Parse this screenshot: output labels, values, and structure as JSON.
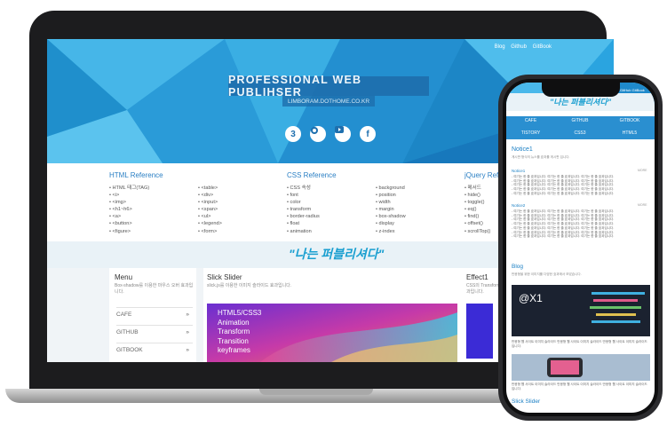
{
  "laptop": {
    "top_links": [
      "Blog",
      "Github",
      "GitBook"
    ],
    "site_title": "PROFESSIONAL WEB PUBLIHSER",
    "site_subtitle": "LIMBORAM.DOTHOME.CO.KR",
    "social_icons": [
      "css3-icon",
      "github-icon",
      "youtube-icon",
      "facebook-icon"
    ],
    "references": [
      {
        "title": "HTML Reference",
        "col1": [
          "HTML 태그(TAG)",
          "<i>",
          "<img>",
          "<h1~h6>",
          "<a>",
          "<button>",
          "<figure>"
        ],
        "col2": [
          "<table>",
          "<div>",
          "<input>",
          "<span>",
          "<ul>",
          "<legend>",
          "<form>"
        ]
      },
      {
        "title": "CSS Reference",
        "col1": [
          "CSS 속성",
          "font",
          "color",
          "transform",
          "border-radius",
          "float",
          "animation"
        ],
        "col2": [
          "background",
          "position",
          "width",
          "margin",
          "box-shadow",
          "display",
          "z-index"
        ]
      },
      {
        "title": "jQuery Refe",
        "col1": [
          "메서드",
          "hide()",
          "toggle()",
          "eq()",
          "find()",
          "offset()",
          "scrollTop()"
        ]
      }
    ],
    "slogan": "\"나는 퍼블리셔다\"",
    "menu": {
      "title": "Menu",
      "desc": "Box-shadow를 이용한 마우스 오버 효과입니다.",
      "items": [
        "CAFE",
        "GITHUB",
        "GITBOOK"
      ],
      "arrow": "»"
    },
    "slick": {
      "title": "Slick Slider",
      "desc": "slick.js를 이용한 이미지 슬라이드 효과입니다.",
      "words": [
        "HTML5/CSS3",
        "Animation",
        "Transform",
        "Transition",
        "keyframes"
      ]
    },
    "effect": {
      "title": "Effect1",
      "desc": "CSS의 Transform",
      "desc2": "과입니다."
    }
  },
  "phone": {
    "top_links": [
      "GitHub",
      "GitBook"
    ],
    "slogan": "\"나는 퍼블리셔다\"",
    "nav": [
      "CAFE",
      "GITHUB",
      "GITBOOK",
      "TISTORY",
      "CSS3",
      "HTML5"
    ],
    "notice_title": "Notice1",
    "notice_desc": "게시판 형식의 뉴스를 효과를 게시판 입니다.",
    "notices": [
      {
        "label": "Notice1",
        "more": "MORE"
      },
      {
        "label": "Notice2",
        "more": "MORE"
      }
    ],
    "notice_line": "- 여기는 한 줄 효과입니다. 여기는 한 줄 효과입니다. 여기는 한 줄 효과입니다.",
    "blog_title": "Blog",
    "blog_desc": "반응형을 위한 이미지를 다양한 효과에서 보았습니다.",
    "blog_img_text": "@X1",
    "blog_caption": "반응형 웹 사이트 이미지 슬라이드 반응형 웹 사이트 이미지 슬라이드 반응형 웹 사이트 이미지 슬라이드 입니다.",
    "slider_title": "Slick Slider"
  }
}
